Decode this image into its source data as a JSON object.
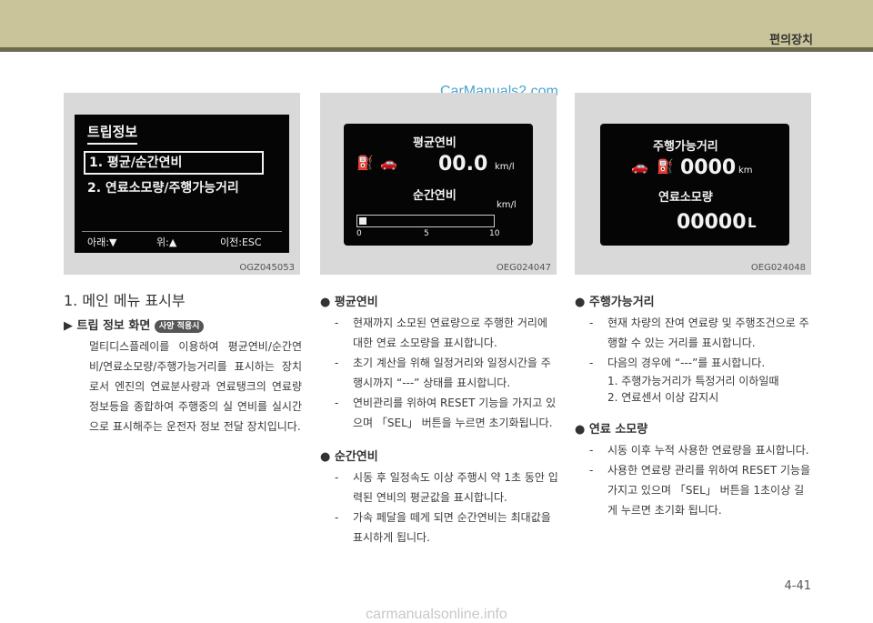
{
  "header": {
    "section_title": "편의장치"
  },
  "watermark": "CarManuals2.com",
  "footer_watermark": "carmanualsonline.info",
  "page_number": "4-41",
  "images": [
    {
      "code": "OGZ045053",
      "screen": {
        "title": "트립정보",
        "item1": "1. 평균/순간연비",
        "item2": "2. 연료소모량/주행가능거리",
        "nav_down": "아래:▼",
        "nav_up": "위:▲",
        "nav_prev": "이전:ESC"
      }
    },
    {
      "code": "OEG024047",
      "screen": {
        "avg_label": "평균연비",
        "avg_value": "00.0",
        "avg_unit": "km/l",
        "inst_label": "순간연비",
        "inst_unit": "km/l",
        "scale": [
          "0",
          "5",
          "10"
        ]
      }
    },
    {
      "code": "OEG024048",
      "screen": {
        "range_label": "주행가능거리",
        "range_value": "0000",
        "range_unit": "km",
        "fuel_label": "연료소모량",
        "fuel_value": "00000",
        "fuel_unit": "L"
      }
    }
  ],
  "left": {
    "heading": "1. 메인 메뉴 표시부",
    "subheading": "▶ 트립 정보 화면",
    "badge": "사양 적용시",
    "paragraph": "멀티디스플레이를 이용하여 평균연비/순간연비/연료소모량/주행가능거리를 표시하는 장치로서 엔진의 연료분사량과 연료탱크의 연료량 정보등을 종합하여 주행중의 실 연비를 실시간으로 표시해주는 운전자 정보 전달 장치입니다."
  },
  "middle": {
    "avg": {
      "title": "평균연비",
      "items": [
        "현재까지 소모된 연료량으로 주행한 거리에 대한 연료 소모량을 표시합니다.",
        "초기 계산을 위해 일정거리와 일정시간을 주행시까지 “---” 상태를 표시합니다.",
        "연비관리를 위하여 RESET 기능을 가지고 있으며 「SEL」 버튼을 누르면 초기화됩니다."
      ]
    },
    "inst": {
      "title": "순간연비",
      "items": [
        "시동 후 일정속도 이상 주행시 약 1초 동안 입력된 연비의 평균값을 표시합니다.",
        "가속 페달을 떼게 되면 순간연비는 최대값을 표시하게 됩니다."
      ]
    }
  },
  "right": {
    "range": {
      "title": "주행가능거리",
      "items": [
        "현재 차량의 잔여 연료량 및 주행조건으로 주행할 수 있는 거리를 표시합니다.",
        "다음의 경우에 “---”를 표시합니다."
      ],
      "subitems": [
        "1. 주행가능거리가 특정거리 이하일때",
        "2. 연료센서 이상 감지시"
      ]
    },
    "fuel": {
      "title": "연료 소모량",
      "items": [
        "시동 이후 누적 사용한 연료량을 표시합니다.",
        "사용한 연료량 관리를 위하여 RESET 기능을 가지고 있으며 「SEL」 버튼을 1초이상 길게 누르면 초기화 됩니다."
      ]
    }
  },
  "bullet_symbol": "●",
  "dash_symbol": "-"
}
